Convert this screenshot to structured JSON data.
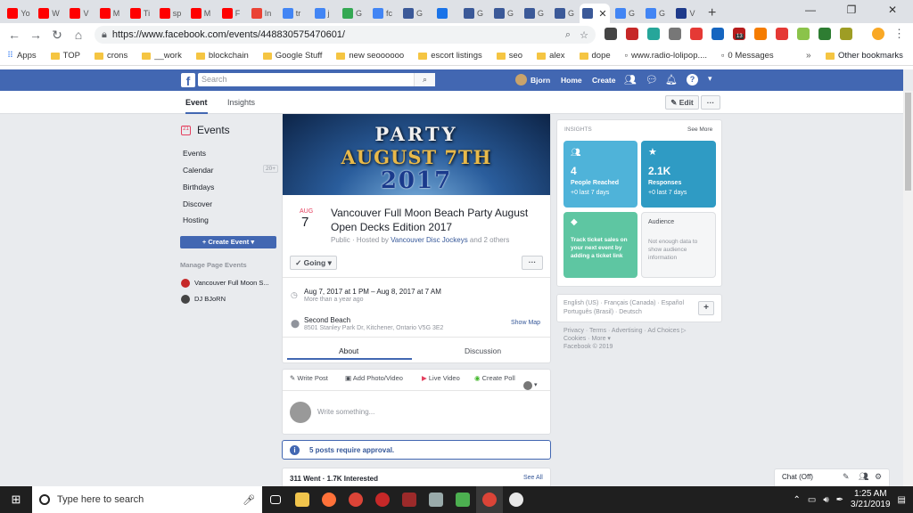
{
  "browser": {
    "tabs": [
      {
        "label": "Yo",
        "color": "#ff0000"
      },
      {
        "label": "W",
        "color": "#ff0000"
      },
      {
        "label": "V",
        "color": "#ff0000"
      },
      {
        "label": "M",
        "color": "#ff0000"
      },
      {
        "label": "Ti",
        "color": "#ff0000"
      },
      {
        "label": "sp",
        "color": "#ff0000"
      },
      {
        "label": "M",
        "color": "#ff0000"
      },
      {
        "label": "F",
        "color": "#ff0000"
      },
      {
        "label": "In",
        "color": "#ea4335"
      },
      {
        "label": "tr",
        "color": "#4285f4"
      },
      {
        "label": "j",
        "color": "#4285f4"
      },
      {
        "label": "G",
        "color": "#34a853"
      },
      {
        "label": "fc",
        "color": "#4285f4"
      },
      {
        "label": "G",
        "color": "#3b5998"
      },
      {
        "label": "",
        "color": "#1a73e8"
      },
      {
        "label": "G",
        "color": "#3b5998"
      },
      {
        "label": "G",
        "color": "#3b5998"
      },
      {
        "label": "G",
        "color": "#3b5998"
      },
      {
        "label": "G",
        "color": "#3b5998"
      },
      {
        "label": "",
        "color": "#3b5998",
        "active": true
      },
      {
        "label": "G",
        "color": "#4285f4"
      },
      {
        "label": "G",
        "color": "#4285f4"
      },
      {
        "label": "V",
        "color": "#1e3a8a"
      }
    ],
    "url": "https://www.facebook.com/events/448830575470601/",
    "bookmarks": [
      "Apps",
      "TOP",
      "crons",
      "__work",
      "blockchain",
      "Google Stuff",
      "new seoooooo",
      "escort listings",
      "seo",
      "alex",
      "dope",
      "www.radio-lolipop....",
      "0 Messages"
    ],
    "other_bookmarks": "Other bookmarks",
    "ext_badge": "13"
  },
  "fb": {
    "logo": "f",
    "search_placeholder": "Search",
    "user": "Bjorn",
    "nav": [
      "Home",
      "Create"
    ],
    "subtabs": [
      "Event",
      "Insights"
    ],
    "edit_label": "Edit",
    "more": "···"
  },
  "sidebar": {
    "title": "Events",
    "items": [
      "Events",
      "Calendar",
      "Birthdays",
      "Discover",
      "Hosting"
    ],
    "calendar_badge": "20+",
    "create_label": "Create Event",
    "manage_title": "Manage Page Events",
    "pages": [
      "Vancouver Full Moon S...",
      "DJ BJoRN"
    ]
  },
  "event": {
    "cover_lines": [
      "PARTY",
      "AUGUST 7TH",
      "2017"
    ],
    "month": "AUG",
    "day": "7",
    "title": "Vancouver Full Moon Beach Party August Open Decks Edition 2017",
    "hosted_prefix": "Public · Hosted by ",
    "host": "Vancouver Disc Jockeys",
    "hosted_suffix": " and 2 others",
    "going": "Going",
    "date": "Aug 7, 2017 at 1 PM – Aug 8, 2017 at 7 AM",
    "date_sub": "More than a year ago",
    "place": "Second Beach",
    "address": "8501 Stanley Park Dr, Kitchener, Ontario V5G 3E2",
    "show_map": "Show Map",
    "tab_about": "About",
    "tab_discussion": "Discussion"
  },
  "composer": {
    "actions": [
      "Write Post",
      "Add Photo/Video",
      "Live Video",
      "Create Poll"
    ],
    "placeholder": "Write something..."
  },
  "approval": "5 posts require approval.",
  "stats": {
    "text": "311 Went · 1.7K Interested",
    "see_all": "See All"
  },
  "insights": {
    "header": "INSIGHTS",
    "see_more": "See More",
    "reached_num": "4",
    "reached_label": "People Reached",
    "reached_sub": "+0 last 7 days",
    "responses_num": "2.1K",
    "responses_label": "Responses",
    "responses_sub": "+0 last 7 days",
    "ticket_text": "Track ticket sales on your next event by adding a ticket link",
    "audience_title": "Audience",
    "audience_text": "Not enough data to show audience information",
    "colors": {
      "reached": "#4fb3d9",
      "responses": "#2f9bc4",
      "ticket": "#5ec6a2"
    }
  },
  "lang": {
    "line1": "English (US) · Français (Canada) · Español",
    "line2": "Português (Brasil) · Deutsch"
  },
  "footer": {
    "line1": "Privacy · Terms · Advertising · Ad Choices ▷",
    "line2": "Cookies · More ▾",
    "line3": "Facebook © 2019"
  },
  "chat": "Chat (Off)",
  "taskbar": {
    "search": "Type here to search",
    "time": "1:25 AM",
    "date": "3/21/2019"
  }
}
